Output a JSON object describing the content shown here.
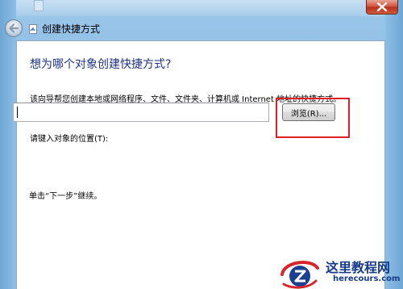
{
  "window": {
    "title": "创建快捷方式",
    "close_icon": "close-icon",
    "back_icon": "back-arrow-icon",
    "title_icon": "shortcut-wizard-icon"
  },
  "wizard": {
    "heading": "想为哪个对象创建快捷方式?",
    "description": "该向导帮您创建本地或网络程序、文件、文件夹、计算机或 Internet 地址的快捷方式。",
    "location_label": "请键入对象的位置(T):",
    "location_value": "",
    "browse_label": "浏览(R)...",
    "hint": "单击“下一步”继续。"
  },
  "annotation": {
    "highlight_color": "#e02020"
  },
  "watermark": {
    "title": "这里教程网",
    "url": "herecours.com",
    "brand_color": "#163a8c"
  }
}
